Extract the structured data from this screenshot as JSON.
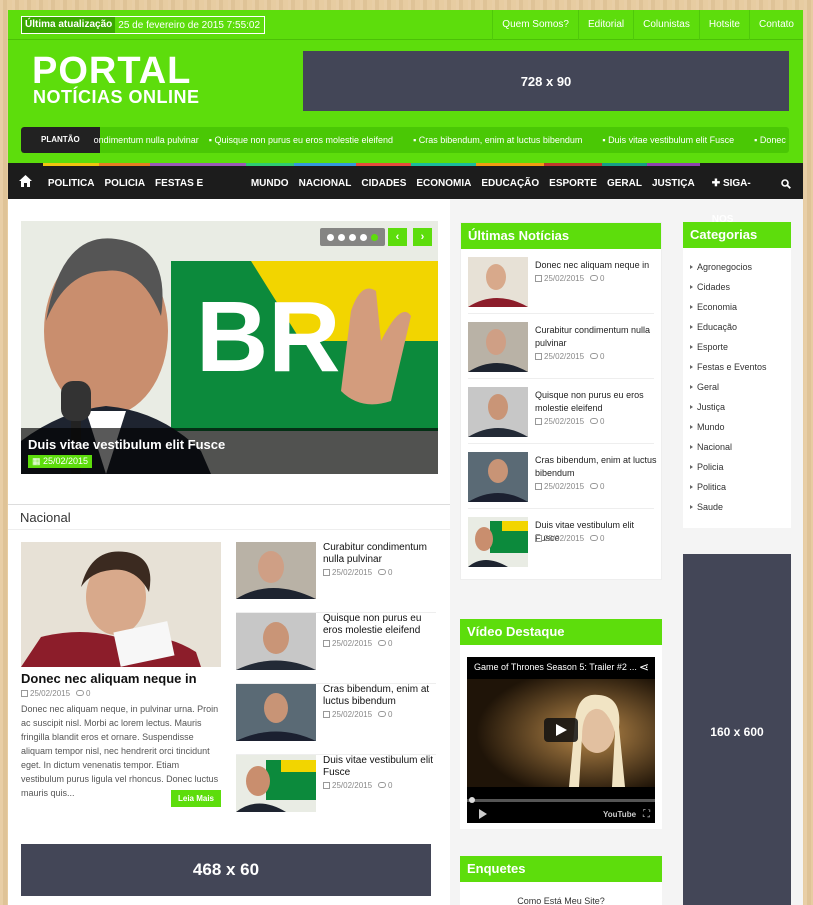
{
  "topbar": {
    "update_label": "Última atualização",
    "update_date": "25 de fevereiro de 2015 7:55:02",
    "links": [
      "Quem Somos?",
      "Editorial",
      "Colunistas",
      "Hotsite",
      "Contato"
    ]
  },
  "header": {
    "logo_line1": "PORTAL",
    "logo_line2": "NOTÍCIAS ONLINE",
    "ad_top": "728 x 90"
  },
  "ticker": {
    "label": "PLANTÃO",
    "items": [
      "ondimentum nulla pulvinar",
      "Quisque non purus eu eros molestie eleifend",
      "Cras bibendum, enim at luctus bibendum",
      "Duis vitae vestibulum elit Fusce",
      "Donec nec aliquam neque in"
    ]
  },
  "nav": {
    "items": [
      "POLITICA",
      "POLICIA",
      "FESTAS E EVENTOS",
      "MUNDO",
      "NACIONAL",
      "CIDADES",
      "ECONOMIA",
      "EDUCAÇÃO",
      "ESPORTE",
      "GERAL",
      "JUSTIÇA"
    ],
    "follow": "SIGA-NOS"
  },
  "slider": {
    "title": "Duis vitae vestibulum elit Fusce",
    "date": "25/02/2015",
    "image_text": "BR"
  },
  "nacional": {
    "title": "Nacional",
    "main": {
      "title": "Donec nec aliquam neque in",
      "date": "25/02/2015",
      "comments": "0",
      "excerpt": "Donec nec aliquam neque, in pulvinar urna. Proin ac suscipit nisl. Morbi ac lorem lectus. Mauris fringilla blandit eros et ornare. Suspendisse aliquam tempor nisl, nec hendrerit orci tincidunt eget. In dictum venenatis tempor. Etiam vestibulum purus ligula vel rhoncus. Donec luctus mauris quis...",
      "more": "Leia Mais"
    },
    "list": [
      {
        "title": "Curabitur condimentum nulla pulvinar",
        "date": "25/02/2015",
        "comments": "0"
      },
      {
        "title": "Quisque non purus eu eros molestie eleifend",
        "date": "25/02/2015",
        "comments": "0"
      },
      {
        "title": "Cras bibendum, enim at luctus bibendum",
        "date": "25/02/2015",
        "comments": "0"
      },
      {
        "title": "Duis vitae vestibulum elit Fusce",
        "date": "25/02/2015",
        "comments": "0"
      }
    ]
  },
  "ad_bottom": "468 x 60",
  "ultimas": {
    "title": "Últimas Notícias",
    "items": [
      {
        "title": "Donec nec aliquam neque in",
        "date": "25/02/2015",
        "comments": "0"
      },
      {
        "title": "Curabitur condimentum nulla pulvinar",
        "date": "25/02/2015",
        "comments": "0"
      },
      {
        "title": "Quisque non purus eu eros molestie eleifend",
        "date": "25/02/2015",
        "comments": "0"
      },
      {
        "title": "Cras bibendum, enim at luctus bibendum",
        "date": "25/02/2015",
        "comments": "0"
      },
      {
        "title": "Duis vitae vestibulum elit Fusce",
        "date": "25/02/2015",
        "comments": "0"
      }
    ]
  },
  "video": {
    "title": "Vídeo Destaque",
    "video_title": "Game of Thrones Season 5: Trailer #2 ...",
    "brand": "YouTube"
  },
  "enquetes": {
    "title": "Enquetes",
    "question": "Como Está Meu Site?"
  },
  "categorias": {
    "title": "Categorias",
    "items": [
      "Agronegocios",
      "Cidades",
      "Economia",
      "Educação",
      "Esporte",
      "Festas e Eventos",
      "Geral",
      "Justiça",
      "Mundo",
      "Nacional",
      "Policia",
      "Politica",
      "Saude"
    ]
  },
  "ad_side": "160 x 600",
  "colors": {
    "accent": "#5ddd0c",
    "nav": "#1c1c1c",
    "ad": "#434657"
  }
}
